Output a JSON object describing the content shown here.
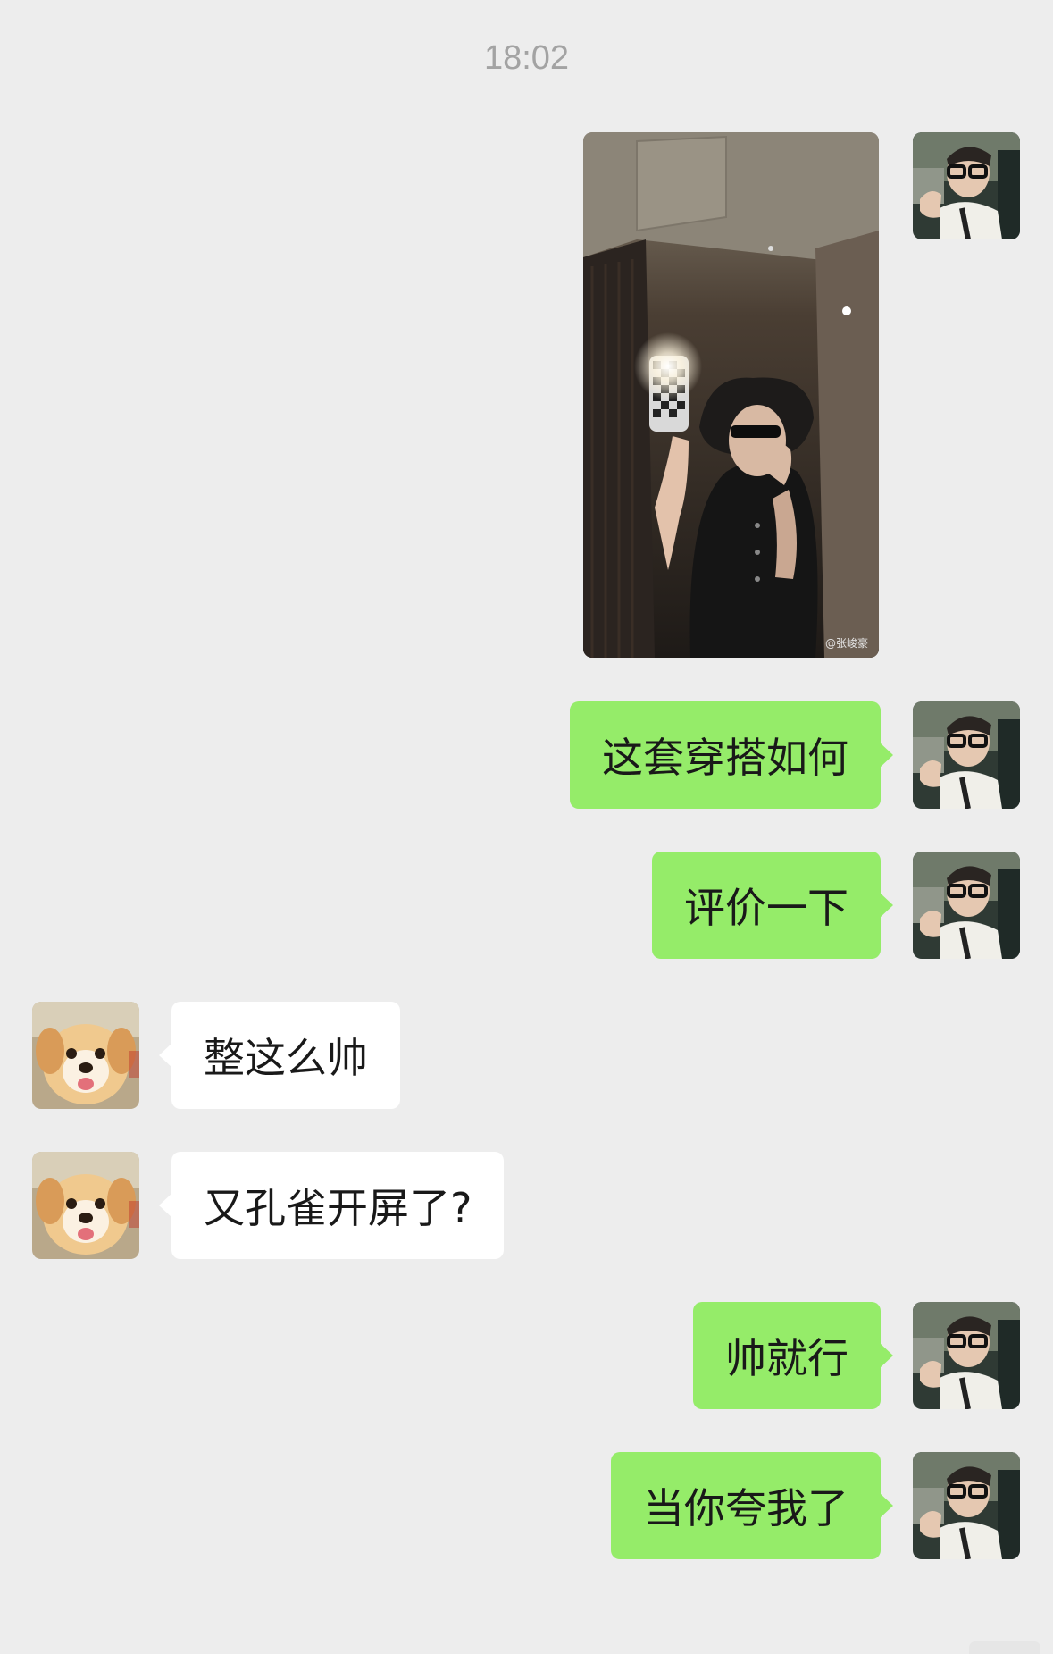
{
  "chat": {
    "timestamp": "18:02",
    "photo": {
      "watermark": "@张峻豪"
    },
    "messages": [
      {
        "sender": "me",
        "text": "这套穿搭如何"
      },
      {
        "sender": "me",
        "text": "评价一下"
      },
      {
        "sender": "friend",
        "text": "整这么帅"
      },
      {
        "sender": "friend",
        "text": "又孔雀开屏了?"
      },
      {
        "sender": "me",
        "text": "帅就行"
      },
      {
        "sender": "me",
        "text": "当你夸我了"
      }
    ]
  },
  "colors": {
    "background": "#ededed",
    "outgoing_bubble": "#95ec69",
    "incoming_bubble": "#ffffff",
    "timestamp_text": "#a3a3a3",
    "message_text": "#191919"
  }
}
